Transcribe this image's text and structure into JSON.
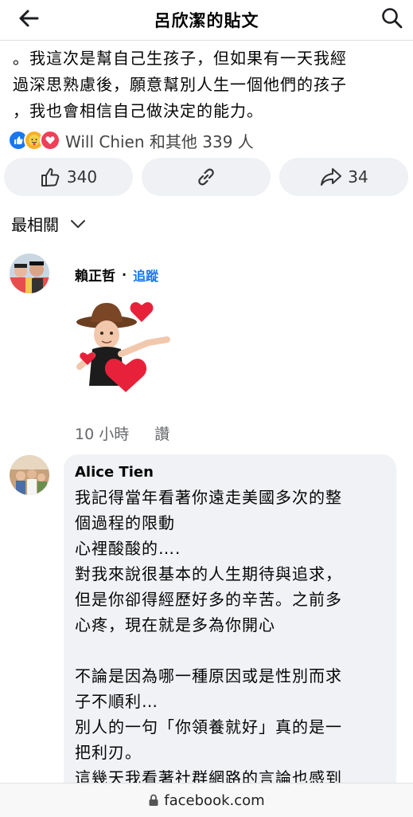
{
  "header": {
    "title": "呂欣潔的貼文"
  },
  "post": {
    "text": "。我這次是幫自己生孩子，但如果有一天我經\n過深思熟慮後，願意幫別人生一個他們的孩子\n，我也會相信自己做決定的能力。"
  },
  "reactions": {
    "summary": "Will Chien 和其他 339 人",
    "like_color": "#1877f2",
    "care_color": "#f7b125",
    "love_color": "#f33e58"
  },
  "actions": {
    "like_count": "340",
    "share_count": "34"
  },
  "sort": {
    "label": "最相關"
  },
  "comments": [
    {
      "author": "賴正哲",
      "follow": "追蹤",
      "time": "10 小時",
      "like": "讚"
    },
    {
      "author": "Alice Tien",
      "text": "我記得當年看著你遠走美國多次的整\n個過程的限動\n心裡酸酸的….\n對我來說很基本的人生期待與追求，\n但是你卻得經歷好多的辛苦。之前多\n心疼，現在就是多為你開心\n\n不論是因為哪一種原因或是性別而求\n子不順利…\n別人的一句「你領養就好」真的是一\n把利刃。\n這幾天我看著社群網路的言論也感到"
    }
  ],
  "browser": {
    "url": "facebook.com"
  }
}
